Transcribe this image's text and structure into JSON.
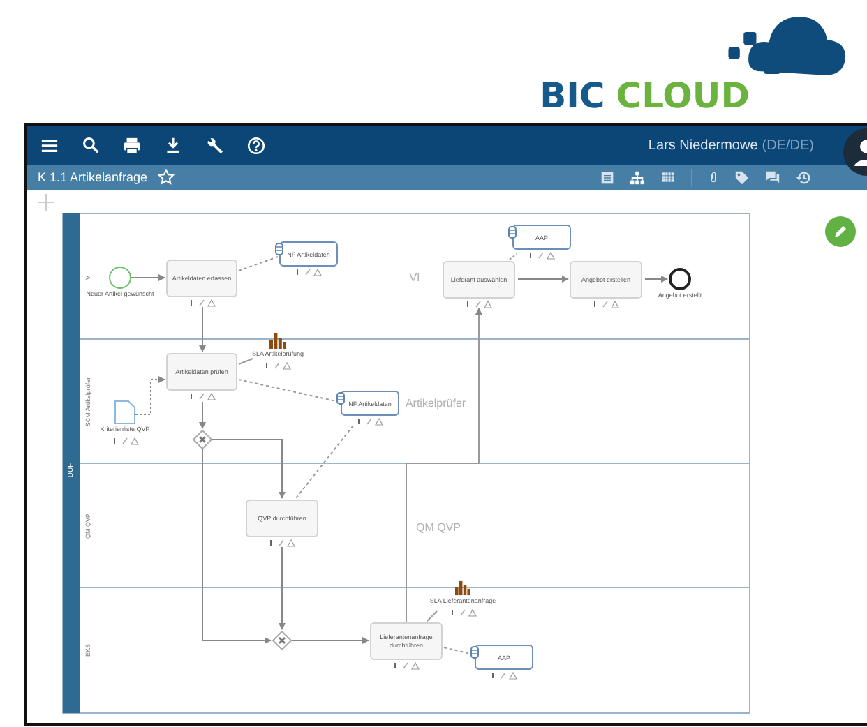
{
  "logo": {
    "word_1": "BIC",
    "word_2": "CLOUD"
  },
  "user": {
    "name": "Lars Niedermowe",
    "locale": "(DE/DE)"
  },
  "title_bar": {
    "title": "K 1.1 Artikelanfrage",
    "favorite": false
  },
  "diagram": {
    "pool": "DUF",
    "lanes": [
      {
        "label": "V"
      },
      {
        "label": "SCM Artikelprüfer"
      },
      {
        "label": "QM QVP"
      },
      {
        "label": "EKS"
      }
    ],
    "background_labels": [
      "VI",
      "Artikelprüfer",
      "QM QVP"
    ],
    "nodes": [
      {
        "kind": "data",
        "label": "AAP"
      },
      {
        "kind": "data",
        "label": "NF Artikeldaten"
      },
      {
        "kind": "start",
        "label": "Neuer Artikel gewünscht"
      },
      {
        "kind": "task",
        "label": "Artikeldaten erfassen"
      },
      {
        "kind": "task",
        "label": "Lieferant auswählen"
      },
      {
        "kind": "task",
        "label": "Angebot erstellen"
      },
      {
        "kind": "end",
        "label": "Angebot erstellt"
      },
      {
        "kind": "sla",
        "label": "SLA Artikelprüfung"
      },
      {
        "kind": "task",
        "label": "Artikeldaten prüfen"
      },
      {
        "kind": "data",
        "label": "NF Artikeldaten"
      },
      {
        "kind": "document",
        "label": "Kriterienliste QVP"
      },
      {
        "kind": "gateway"
      },
      {
        "kind": "task",
        "label": "QVP durchführen"
      },
      {
        "kind": "sla",
        "label": "SLA Lieferantenanfrage"
      },
      {
        "kind": "task",
        "label": "Lieferantenanfrage durchführen"
      },
      {
        "kind": "gateway"
      },
      {
        "kind": "data",
        "label": "AAP"
      }
    ]
  }
}
